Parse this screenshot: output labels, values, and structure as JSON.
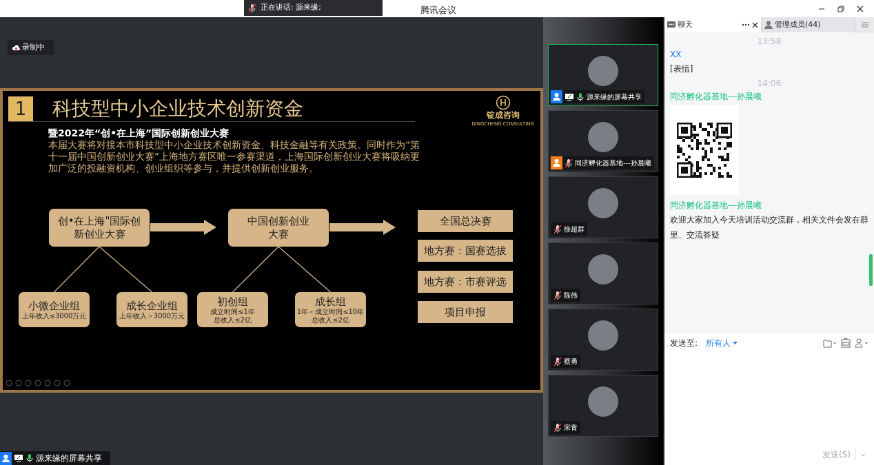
{
  "window": {
    "title": "腾讯会议",
    "speaking": "正在讲话: 源来缘;"
  },
  "recording": {
    "label": "录制中"
  },
  "slide": {
    "number": "1",
    "title": "科技型中小企业技术创新资金",
    "logo": {
      "name": "锭成咨询",
      "tagline": "DINGCHENG CONSULTING"
    },
    "subtitle": "暨2022年“创•在上海”国际创新创业大赛",
    "body": "本届大赛将对接本市科技型中小企业技术创新资金、科技金融等有关政策。同时作为“第十一届中国创新创业大赛”上海地方赛区唯一参赛渠道，上海国际创新创业大赛将吸纳更加广泛的投融资机构、创业组织等参与，并提供创新创业服务。",
    "competitions": [
      {
        "label": "创•在上海\"国际创新创业大赛",
        "groups": [
          {
            "name": "小微企业组",
            "criteria": [
              "上年收入≤3000万元"
            ]
          },
          {
            "name": "成长企业组",
            "criteria": [
              "上年收入＞3000万元"
            ]
          }
        ]
      },
      {
        "label": "中国创新创业大赛",
        "groups": [
          {
            "name": "初创组",
            "criteria": [
              "成立时间≤1年",
              "总收入≤2亿"
            ]
          },
          {
            "name": "成长组",
            "criteria": [
              "1年＜成立时间≤10年",
              "总收入≤2亿"
            ]
          }
        ]
      }
    ],
    "stages": [
      "全国总决赛",
      "地方赛：国赛选拔",
      "地方赛：市赛评选",
      "项目申报"
    ]
  },
  "share_label": "源来缘的屏幕共享",
  "participants": [
    {
      "name": "源来缘的屏幕共享",
      "host": true,
      "cohost": false,
      "sharing": true,
      "muted": false,
      "selected": true
    },
    {
      "name": "同济孵化器基地---孙晨曦",
      "host": false,
      "cohost": true,
      "sharing": false,
      "muted": true,
      "selected": false
    },
    {
      "name": "徐超群",
      "host": false,
      "cohost": false,
      "sharing": false,
      "muted": true,
      "selected": false
    },
    {
      "name": "陈伟",
      "host": false,
      "cohost": false,
      "sharing": false,
      "muted": true,
      "selected": false
    },
    {
      "name": "蔡勇",
      "host": false,
      "cohost": false,
      "sharing": false,
      "muted": true,
      "selected": false
    },
    {
      "name": "宋青",
      "host": false,
      "cohost": false,
      "sharing": false,
      "muted": true,
      "selected": false
    }
  ],
  "chat": {
    "tabs": [
      {
        "label": "聊天",
        "selected": true
      },
      {
        "label": "管理成员(44)",
        "selected": false
      }
    ],
    "messages": [
      {
        "kind": "time",
        "text": "13:58"
      },
      {
        "kind": "text",
        "sender": "XX",
        "color": "#1a7cf5",
        "text": "[表情]"
      },
      {
        "kind": "time",
        "text": "14:06"
      },
      {
        "kind": "image",
        "sender": "同济孵化器基地---孙晨曦",
        "color": "#12c27b"
      },
      {
        "kind": "text",
        "sender": "同济孵化器基地---孙晨曦",
        "color": "#12c27b",
        "text": "欢迎大家加入今天培训活动交流群，相关文件会发在群里、交流答疑"
      }
    ],
    "send_to_label": "发送至:",
    "send_to": "所有人",
    "send_button": "发送(S)"
  }
}
